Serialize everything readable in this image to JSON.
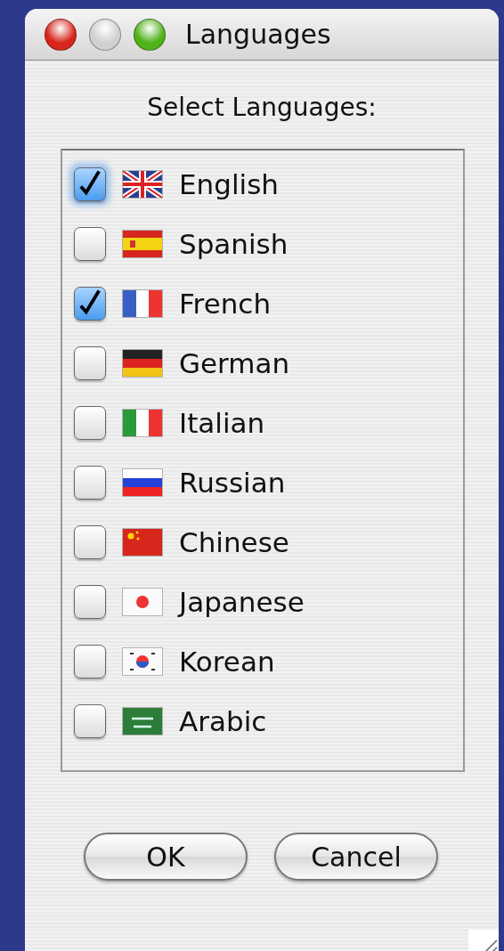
{
  "window": {
    "title": "Languages",
    "minimize_enabled": false
  },
  "heading": "Select Languages:",
  "languages": [
    {
      "label": "English",
      "checked": true,
      "focused": true
    },
    {
      "label": "Spanish",
      "checked": false,
      "focused": false
    },
    {
      "label": "French",
      "checked": true,
      "focused": false
    },
    {
      "label": "German",
      "checked": false,
      "focused": false
    },
    {
      "label": "Italian",
      "checked": false,
      "focused": false
    },
    {
      "label": "Russian",
      "checked": false,
      "focused": false
    },
    {
      "label": "Chinese",
      "checked": false,
      "focused": false
    },
    {
      "label": "Japanese",
      "checked": false,
      "focused": false
    },
    {
      "label": "Korean",
      "checked": false,
      "focused": false
    },
    {
      "label": "Arabic",
      "checked": false,
      "focused": false
    }
  ],
  "buttons": [
    "OK",
    "Cancel"
  ]
}
